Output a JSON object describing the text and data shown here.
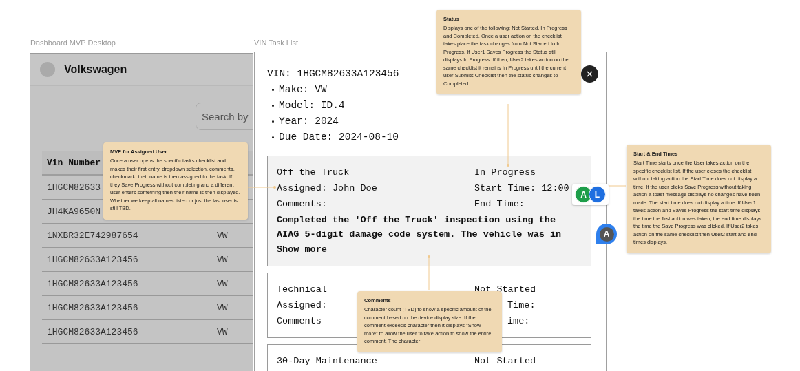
{
  "dashboard": {
    "frame_label": "Dashboard MVP Desktop",
    "brand": "Volkswagen",
    "search": {
      "placeholder": "Search by"
    },
    "table": {
      "columns": [
        "Vin Number"
      ],
      "rows": [
        {
          "vin": "1HGCM82633"
        },
        {
          "vin": "JH4KA9650N"
        },
        {
          "vin": "1NXBR32E742987654",
          "make": "VW"
        },
        {
          "vin": "1HGCM82633A123456",
          "make": "VW"
        },
        {
          "vin": "1HGCM82633A123456",
          "make": "VW"
        },
        {
          "vin": "1HGCM82633A123456",
          "make": "VW"
        },
        {
          "vin": "1HGCM82633A123456",
          "make": "VW"
        }
      ]
    }
  },
  "task_list": {
    "frame_label": "VIN Task List",
    "vin": "VIN: 1HGCM82633A123456",
    "details": [
      "Make: VW",
      "Model: ID.4",
      "Year: 2024",
      "Due Date: 2024-08-10"
    ],
    "tasks": [
      {
        "kind": "full",
        "expanded": true,
        "name": "Off the Truck",
        "status": "In Progress",
        "assigned": "Assigned: John Doe",
        "start": "Start Time: 12:00",
        "comments_label": "Comments:",
        "end": "End Time:",
        "comment": "Completed the 'Off the Truck' inspection using the AIAG 5-digit damage code system. The vehicle was in",
        "show_more": "Show more"
      },
      {
        "kind": "partial",
        "expanded": false,
        "name": "Technical",
        "status": "Not Started",
        "assigned": "Assigned:",
        "start": "Time:",
        "comments_label": "Comments",
        "end": "ime:"
      },
      {
        "kind": "full",
        "expanded": false,
        "name": "30-Day Maintenance",
        "status": "Not Started"
      }
    ]
  },
  "collaborators": [
    {
      "initial": "A",
      "color": "#1e9e4a"
    },
    {
      "initial": "L",
      "color": "#1f6fe0"
    }
  ],
  "comment_pin": {
    "initial": "A",
    "color": "#2f80ed"
  },
  "notes": [
    {
      "title": "Status",
      "body": "Displays one of the following: Not Started, In Progress and Completed. Once a user action on the checklist takes place the task changes from Not Started to In Progress. If User1 Saves Progress the Status still displays In Progress. If then, User2 takes action on the same checklist it remains In Progress until the current user Submits Checklist then the status changes to Completed."
    },
    {
      "title": "MVP for Assigned User",
      "body": "Once a user opens the specific tasks checklist and makes their first entry, dropdown selection, comments, checkmark, their name is then assigned to the task. If they Save Progress without completing and a different user enters something then their name is then displayed. Whether we keep all names listed or just the last user is still TBD."
    },
    {
      "title": "Start & End Times",
      "body": "Start Time starts once the User takes action on the specific checklist list. If the user closes the checklist without taking action the Start Time does not display a time. If the user clicks Save Progress without taking action a toast message displays no changes have been made. The start time does not display a time. If User1 takes action and Saves Progress the start time displays the time the first action was taken, the end time displays the time the Save Progress was clicked. If User2 takes action on the same checklist then User2 start and end times displays."
    },
    {
      "title": "Comments",
      "body": "Character count (TBD) to show a specific amount of the comment based on the device display size. If the comment exceeds character then it displays \"Show more\" to allow the user to take action to show the entire comment. The character"
    }
  ]
}
